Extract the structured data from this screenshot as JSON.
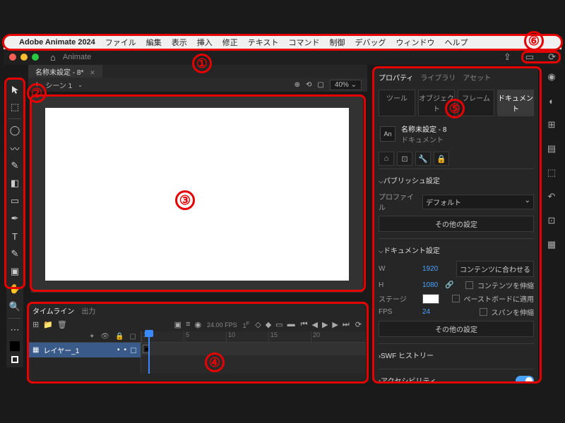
{
  "menubar": {
    "app_name": "Adobe Animate 2024",
    "items": [
      "ファイル",
      "編集",
      "表示",
      "挿入",
      "修正",
      "テキスト",
      "コマンド",
      "制御",
      "デバッグ",
      "ウィンドウ",
      "ヘルプ"
    ]
  },
  "app_tabs": {
    "animate_label": "Animate"
  },
  "doc_tab": {
    "name": "名称未設定 - 8*"
  },
  "scene_bar": {
    "scene_label": "シーン 1",
    "zoom": "40%"
  },
  "properties": {
    "tabs": {
      "prop": "プロパティ",
      "lib": "ライブラリ",
      "asset": "アセット"
    },
    "subtabs": {
      "tool": "ツール",
      "object": "オブジェクト",
      "frame": "フレーム",
      "document": "ドキュメント"
    },
    "doc_name": "名称未設定 - 8",
    "doc_type": "ドキュメント",
    "publish": {
      "header": "パブリッシュ設定",
      "profile_label": "プロファイル",
      "profile_value": "デフォルト",
      "more": "その他の設定"
    },
    "docset": {
      "header": "ドキュメント設定",
      "w_label": "W",
      "w_value": "1920",
      "h_label": "H",
      "h_value": "1080",
      "fit_content": "コンテンツに合わせる",
      "scale_content": "コンテンツを伸縮",
      "stage_label": "ステージ",
      "apply_pasteboard": "ペーストボードに適用",
      "fps_label": "FPS",
      "fps_value": "24",
      "scale_span": "スパンを伸縮",
      "more": "その他の設定"
    },
    "swf_history": "SWF ヒストリー",
    "accessibility": "アクセシビリティ"
  },
  "timeline": {
    "tabs": {
      "timeline": "タイムライン",
      "output": "出力"
    },
    "fps_display": "24.00",
    "fps_unit": "FPS",
    "frame_display": "1",
    "frame_unit": "F",
    "layer_name": "レイヤー_1",
    "ruler": [
      "1",
      "5",
      "10",
      "15",
      "20"
    ]
  },
  "callouts": {
    "c1": "①",
    "c2": "②",
    "c3": "③",
    "c4": "④",
    "c5": "⑤",
    "c6": "⑥"
  }
}
